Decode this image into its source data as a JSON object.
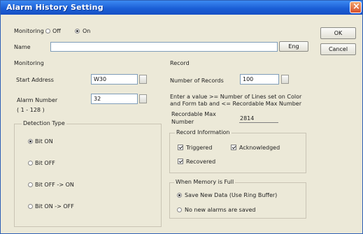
{
  "window": {
    "title": "Alarm History Setting"
  },
  "top": {
    "monitoring_label": "Monitoring",
    "off_label": "Off",
    "on_label": "On",
    "name_label": "Name",
    "name_value": "",
    "eng_button": "Eng"
  },
  "buttons": {
    "ok": "OK",
    "cancel": "Cancel"
  },
  "monitoring": {
    "section_label": "Monitoring",
    "start_address_label": "Start Address",
    "start_address_value": "W30",
    "alarm_number_label": "Alarm Number",
    "alarm_number_range": "( 1 - 128 )",
    "alarm_number_value": "32",
    "detection_type_title": "Detection Type",
    "detection_options": [
      "Bit ON",
      "Bit OFF",
      "Bit OFF -> ON",
      "Bit ON -> OFF"
    ],
    "detection_selected": "Bit ON"
  },
  "record": {
    "section_label": "Record",
    "number_of_records_label": "Number of Records",
    "number_of_records_value": "100",
    "hint_line1": "Enter a value >= Number of Lines set on Color",
    "hint_line2": "and Form tab and <= Recordable Max Number",
    "recordable_max_label_1": "Recordable Max",
    "recordable_max_label_2": "Number",
    "recordable_max_value": "2814",
    "record_info_title": "Record Information",
    "triggered_label": "Triggered",
    "acknowledged_label": "Acknowledged",
    "recovered_label": "Recovered",
    "triggered_checked": true,
    "acknowledged_checked": true,
    "recovered_checked": true,
    "memory_full_title": "When Memory is Full",
    "save_new_data_label": "Save New Data (Use Ring Buffer)",
    "no_new_alarms_label": "No new alarms are saved",
    "memory_full_selected": "save_new_data"
  },
  "colors": {
    "titlebar": "#1b5fd6",
    "dialog_bg": "#ece9d8",
    "close_button": "#d8502b"
  }
}
